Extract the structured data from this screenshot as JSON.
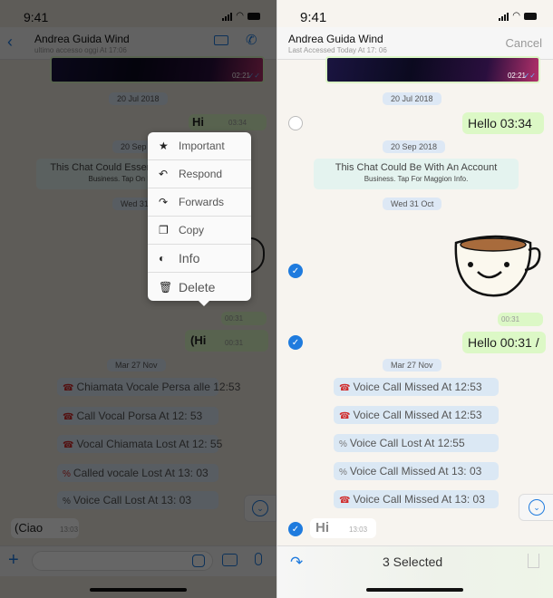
{
  "status_bar": {
    "time": "9:41"
  },
  "left": {
    "header": {
      "contact_name": "Andrea Guida Wind",
      "subtitle": "ultimo accesso oggi At 17:06"
    },
    "media": {
      "time": "02:21",
      "ticks": "✓✓"
    },
    "messages": {
      "date_1": "20 Jul 2018",
      "hi_1": {
        "text": "Hi",
        "time": "03:34"
      },
      "date_2": "20 Sep 2018",
      "system_line1": "This Chat Could Essere With An Account",
      "system_line2": "Business. Tap On For More Info.",
      "date_3": "Wed 31 Oct",
      "sticker_time": "00:31",
      "hi_2": {
        "text": "(Hi",
        "time": "00:31"
      },
      "date_4": "Mar 27 Nov",
      "calls": [
        "Chiamata Vocale Persa alle 12:53",
        "Call Vocal Porsa At 12: 53",
        "Vocal Chiamata Lost At 12: 55",
        "Called  vocale Lost At 13: 03",
        "Voice  Call Lost At 13: 03"
      ],
      "ciao": {
        "text": "(Ciao",
        "time": "13:03"
      }
    },
    "context_menu": [
      {
        "label": "Important",
        "icon": "star-icon",
        "glyph": "★"
      },
      {
        "label": "Respond",
        "icon": "reply-icon",
        "glyph": "↶"
      },
      {
        "label": "Forwards",
        "icon": "forward-icon",
        "glyph": "↷"
      },
      {
        "label": "Copy",
        "icon": "copy-icon",
        "glyph": "❐"
      },
      {
        "label": "Info",
        "icon": "info-icon",
        "glyph": "◐"
      },
      {
        "label": "Delete",
        "icon": "trash-icon",
        "glyph": "🗑"
      }
    ]
  },
  "right": {
    "header": {
      "contact_name": "Andrea Guida Wind",
      "subtitle": "Last Accessed Today At 17: 06",
      "cancel": "Cancel"
    },
    "media": {
      "time": "02:21",
      "ticks": "✓✓"
    },
    "messages": {
      "date_1": "20 Jul 2018",
      "hello_1": "Hello 03:34",
      "date_2": "20 Sep 2018",
      "system_line1": "This Chat Could Be With An Account",
      "system_line2": "Business. Tap For Maggion Info.",
      "date_3": "Wed 31 Oct",
      "sticker_time": "00:31",
      "hello_2": "Hello 00:31 /",
      "date_4": "Mar 27 Nov",
      "calls": [
        {
          "icon": "missed-call-icon",
          "glyph": "☎",
          "text": "Voice Call Missed At 12:53"
        },
        {
          "icon": "missed-call-icon",
          "glyph": "☎",
          "text": "Voice Call Missed At 12:53"
        },
        {
          "icon": "percent-icon",
          "glyph": "%",
          "text": "Voice Call Lost At 12:55"
        },
        {
          "icon": "percent-icon",
          "glyph": "%",
          "text": "Voice Call Missed At 13: 03"
        },
        {
          "icon": "missed-call-icon",
          "glyph": "☎",
          "text": "Voice Call Missed At 13: 03"
        }
      ],
      "hi": {
        "text": "Hi",
        "time": "13:03"
      }
    },
    "selection": {
      "count_label": "3 Selected",
      "selected": [
        false,
        true,
        true,
        true
      ]
    }
  }
}
